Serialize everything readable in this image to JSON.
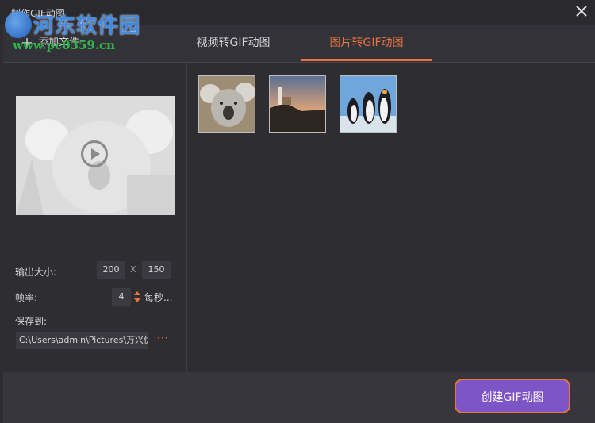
{
  "window": {
    "title": "制作GIF动图",
    "close_icon": "close-icon"
  },
  "watermark": {
    "name": "河东软件园",
    "url": "www.pc0359.cn"
  },
  "tabs": [
    {
      "label": "添加文件",
      "icon": "plus-icon"
    },
    {
      "label": "视频转GIF动图"
    },
    {
      "label": "图片转GIF动图",
      "active": true
    }
  ],
  "settings": {
    "size_label": "输出大小:",
    "width": "200",
    "separator": "X",
    "height": "150",
    "fps_label": "帧率:",
    "fps_value": "4",
    "fps_unit": "每秒...",
    "save_label": "保存到:",
    "save_path": "C:\\Users\\admin\\Pictures\\万兴优",
    "browse_label": "···"
  },
  "thumbnails": [
    {
      "name": "koala"
    },
    {
      "name": "lighthouse"
    },
    {
      "name": "penguins"
    }
  ],
  "actions": {
    "create_label": "创建GIF动图"
  },
  "colors": {
    "accent": "#e8743f",
    "button_bg": "#7d55c7",
    "background": "#2e2d32"
  }
}
